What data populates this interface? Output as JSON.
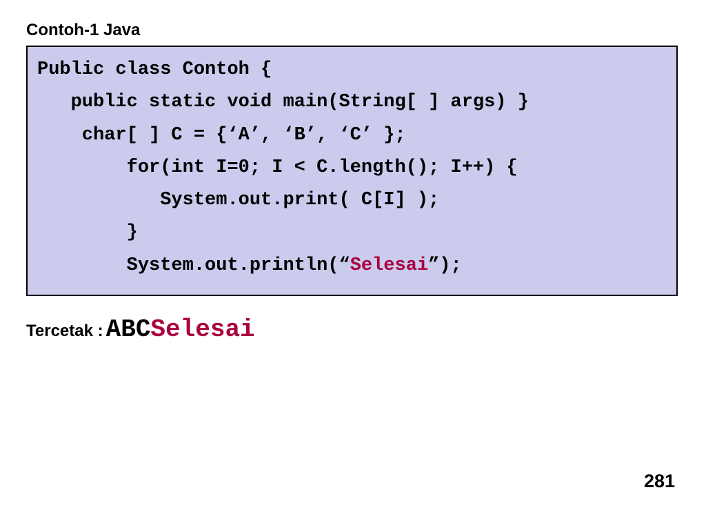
{
  "title": "Contoh-1  Java",
  "code": {
    "line1": "Public class Contoh {",
    "line2": "   public static void main(String[ ] args) }",
    "line3": "    char[ ] C = {‘A’, ‘B’, ‘C’ };",
    "line4": "        for(int I=0; I < C.length(); I++) {",
    "line5": "           System.out.print( C[I] );",
    "line6": "        }",
    "line7_prefix": "        System.out.println(“",
    "line7_highlight": "Selesai",
    "line7_suffix": "”);"
  },
  "output": {
    "label": "Tercetak :",
    "abc": "ABC",
    "selesai": "Selesai"
  },
  "page_number": "281"
}
